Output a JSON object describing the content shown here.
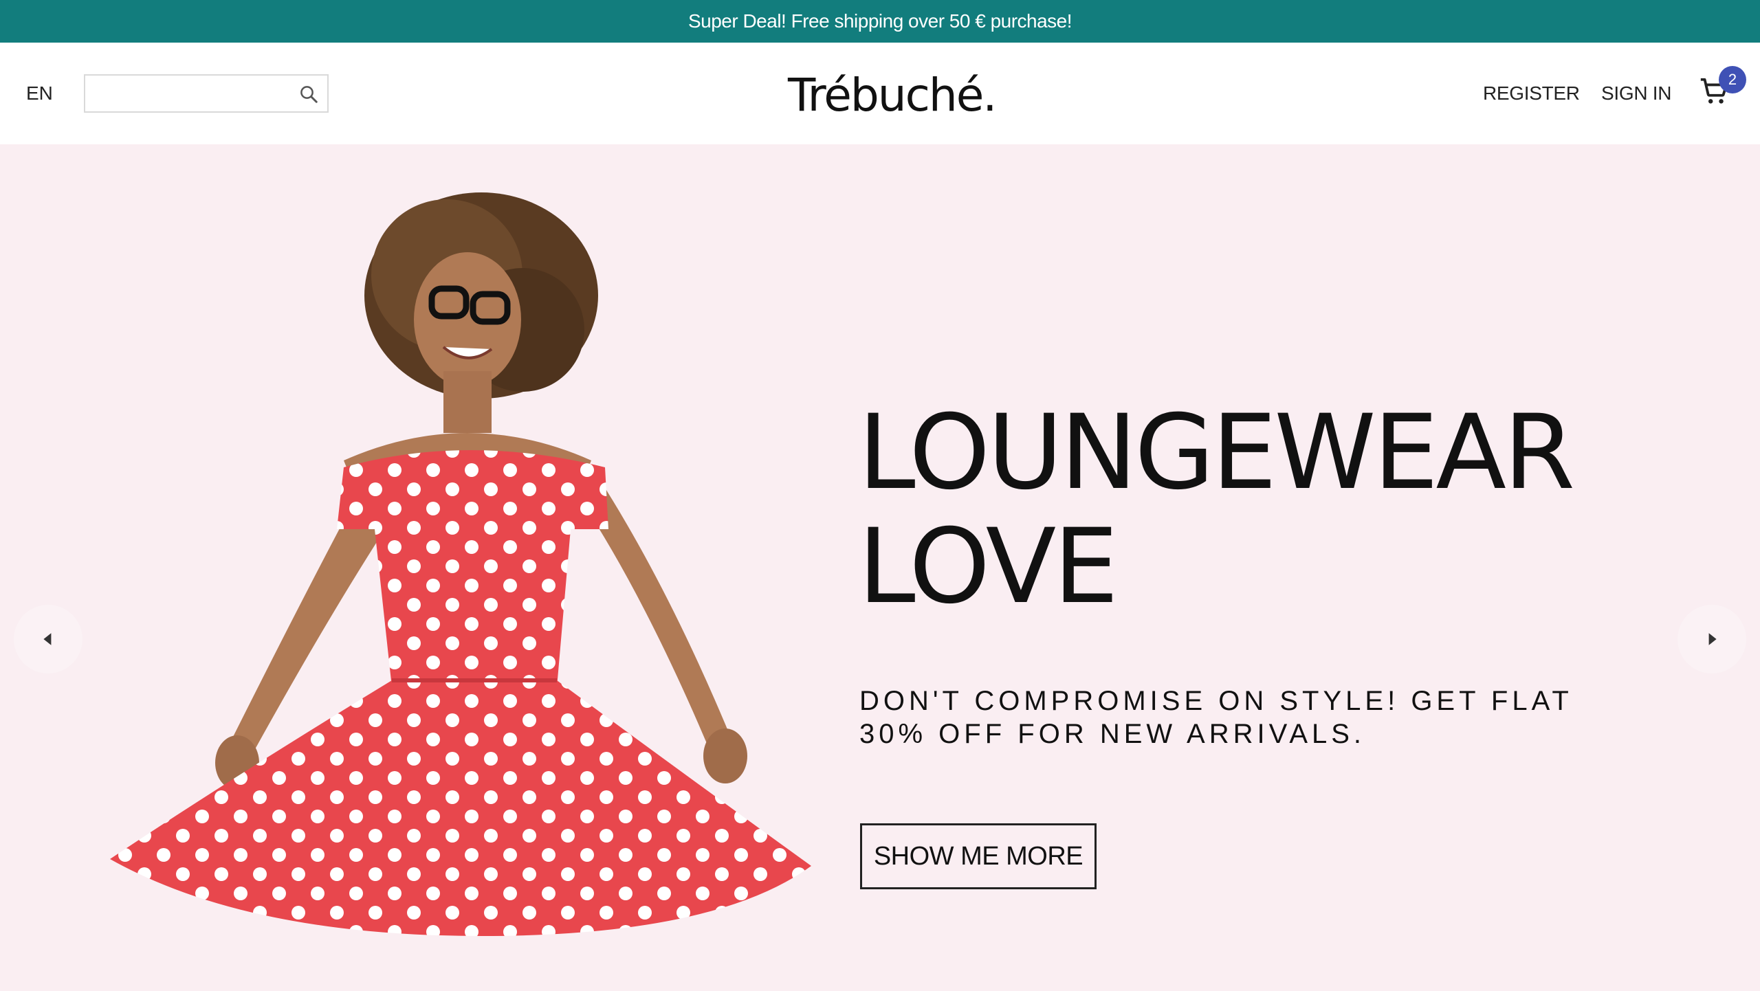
{
  "announcement": {
    "text": "Super Deal! Free shipping over 50 € purchase!"
  },
  "header": {
    "language": "EN",
    "search": {
      "placeholder": "",
      "value": ""
    },
    "logo": "Trébuché.",
    "register_label": "REGISTER",
    "signin_label": "SIGN IN",
    "cart_count": "2"
  },
  "hero": {
    "headline_line1": "LOUNGEWEAR",
    "headline_line2": "LOVE",
    "subline": "DON'T COMPROMISE ON STYLE! GET FLAT 30% OFF FOR NEW ARRIVALS.",
    "cta_label": "SHOW ME MORE"
  },
  "colors": {
    "announcement_bg": "#127d7d",
    "hero_bg": "#faeef2",
    "cart_badge": "#3f51b5",
    "dress_red": "#e8474d"
  },
  "icons": {
    "search": "search-icon",
    "cart": "cart-icon",
    "prev": "chevron-left-icon",
    "next": "chevron-right-icon"
  }
}
